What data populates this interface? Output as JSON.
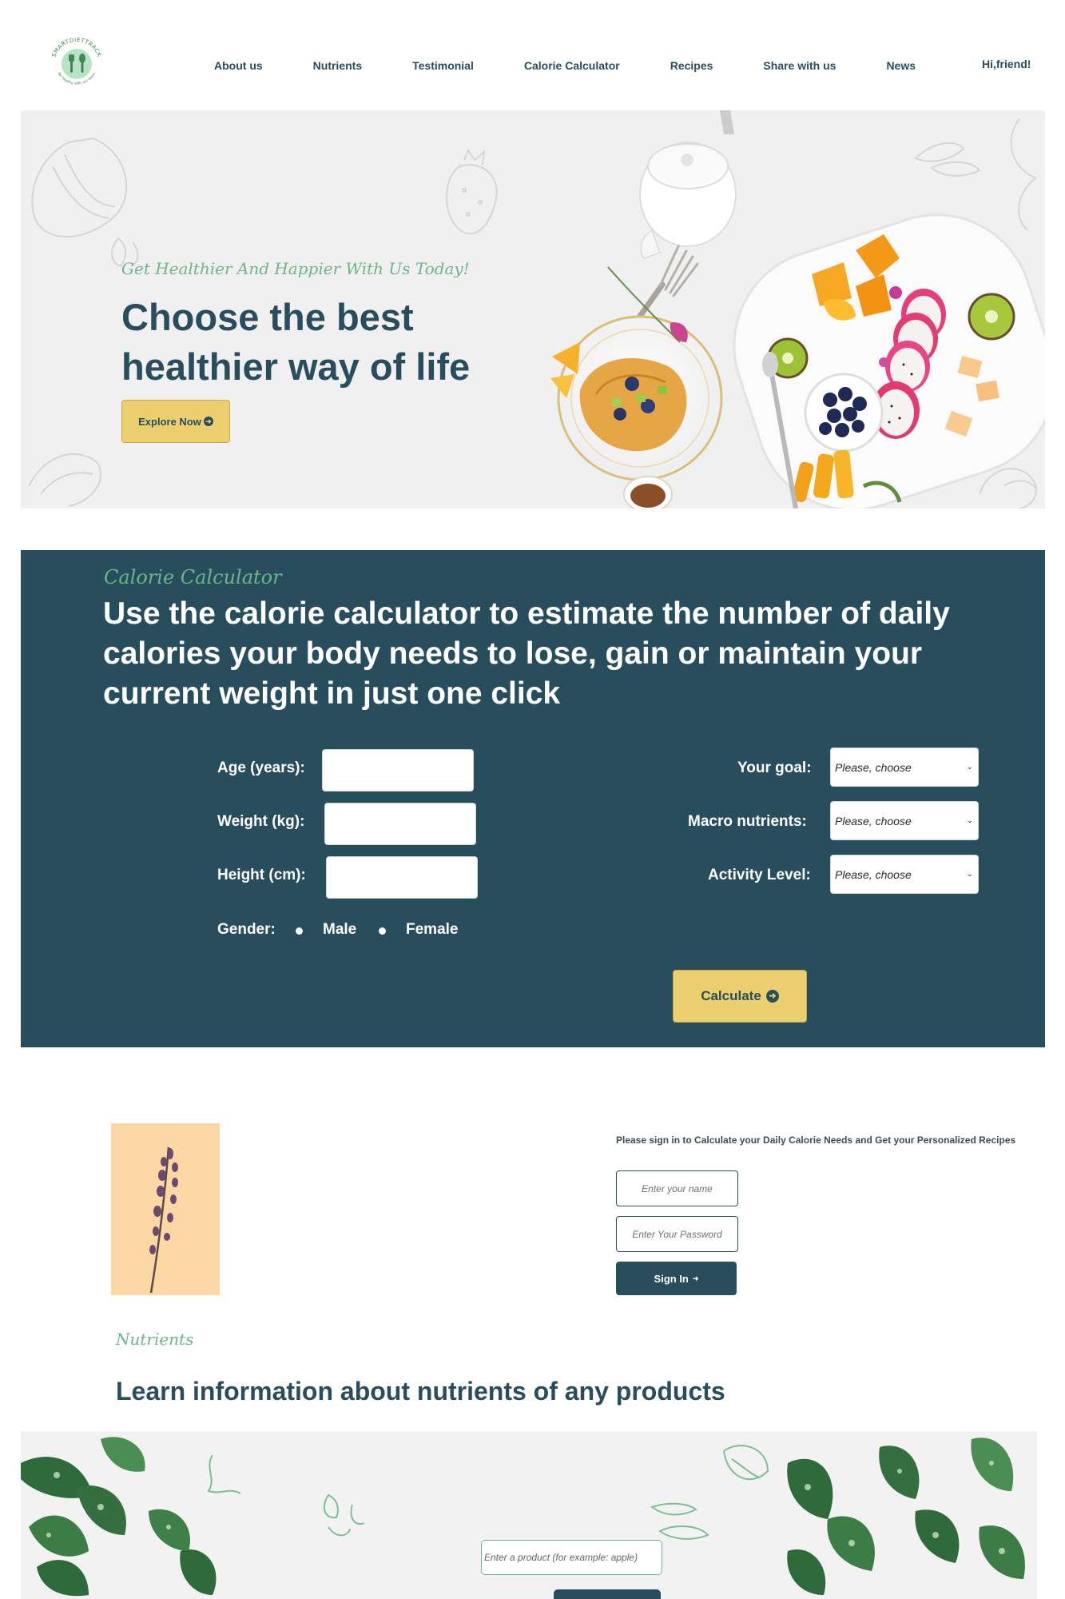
{
  "header": {
    "logo_text": "SMARTDIETTRACK",
    "logo_subtext": "Be healthy with our team",
    "nav": [
      "About us",
      "Nutrients",
      "Testimonial",
      "Calorie Calculator",
      "Recipes",
      "Share with us",
      "News"
    ],
    "greeting": "Hi,friend!"
  },
  "hero": {
    "tagline": "Get Healthier And Happier With Us Today!",
    "title": "Choose the best healthier way of life",
    "button_label": "Explore Now"
  },
  "calculator": {
    "tag": "Calorie Calculator",
    "title": "Use the calorie calculator to estimate the number of daily calories your body needs to lose, gain or maintain your current weight in just one click",
    "age_label": "Age (years):",
    "weight_label": "Weight (kg):",
    "height_label": "Height (cm):",
    "gender_label": "Gender:",
    "gender_options": [
      "Male",
      "Female"
    ],
    "goal_label": "Your goal:",
    "macro_label": "Macro nutrients:",
    "activity_label": "Activity Level:",
    "select_placeholder": "Please, choose",
    "button_label": "Calculate"
  },
  "signin": {
    "heading": "Please sign in to Calculate your Daily Calorie Needs and Get your Personalized Recipes",
    "name_placeholder": "Enter your name",
    "password_placeholder": "Enter Your Password",
    "button_label": "Sign In"
  },
  "nutrients": {
    "tag": "Nutrients",
    "title": "Learn information about nutrients of any products",
    "search_placeholder": "Enter a product (for example: apple)"
  },
  "colors": {
    "primary": "#284d5c",
    "accent": "#ecd06f",
    "green": "#6bb68a",
    "hero_bg": "#f1f0f1"
  }
}
